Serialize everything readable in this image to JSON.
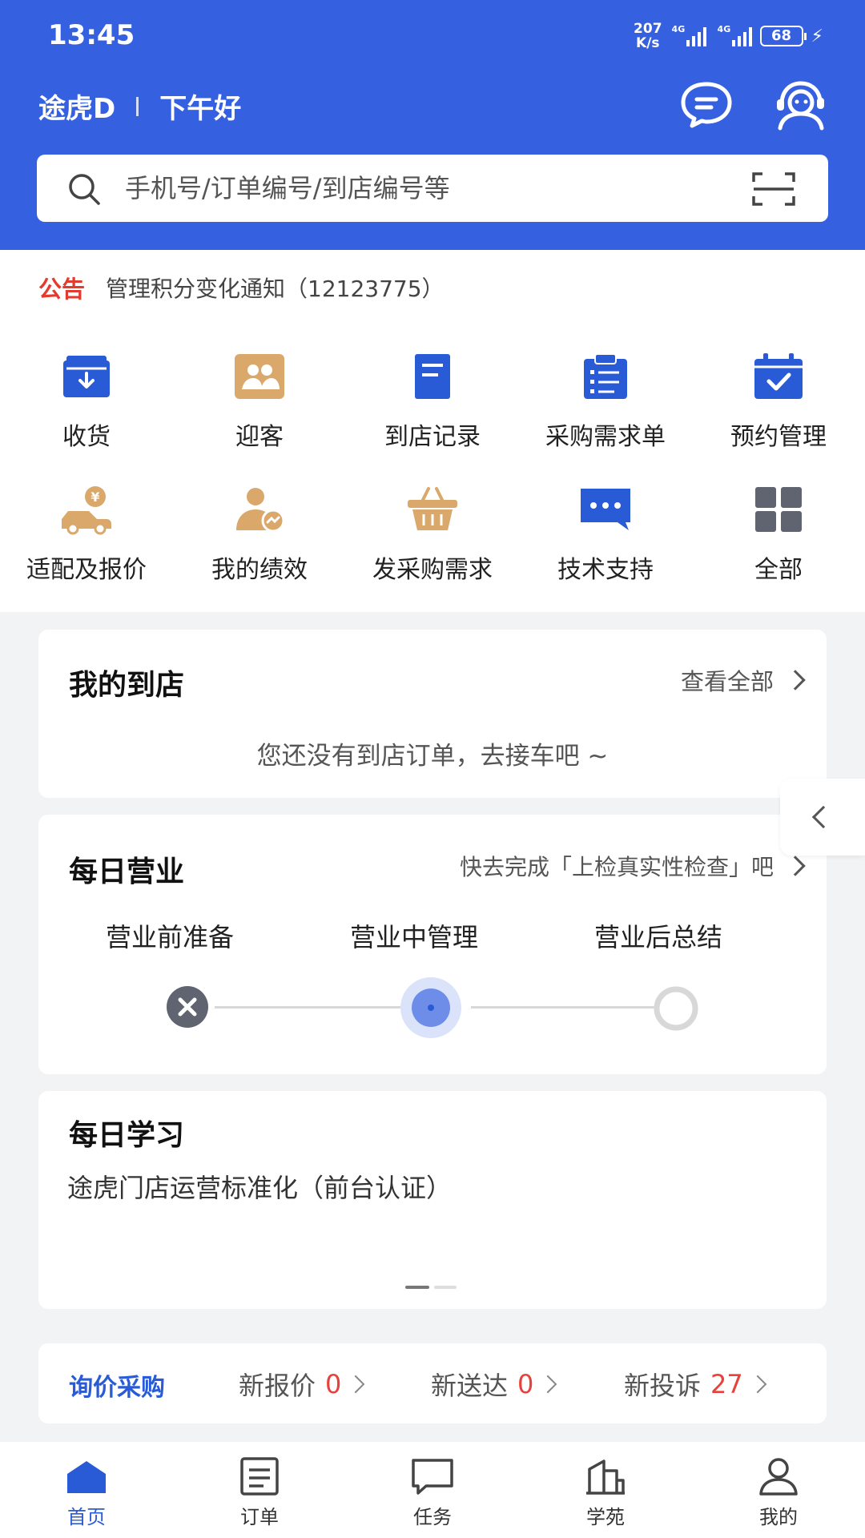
{
  "status_bar": {
    "time": "13:45",
    "net_speed_value": "207",
    "net_speed_unit": "K/s",
    "signal_1_tag": "4G",
    "signal_2_tag": "4G",
    "battery": "68"
  },
  "header": {
    "brand": "途虎D",
    "greeting": "下午好"
  },
  "search": {
    "placeholder": "手机号/订单编号/到店编号等"
  },
  "notice": {
    "tag": "公告",
    "text": "管理积分变化通知（12123775）"
  },
  "menu": [
    {
      "label": "收货",
      "icon": "receive-goods-icon"
    },
    {
      "label": "迎客",
      "icon": "welcome-guest-icon"
    },
    {
      "label": "到店记录",
      "icon": "store-record-icon"
    },
    {
      "label": "采购需求单",
      "icon": "purchase-list-icon"
    },
    {
      "label": "预约管理",
      "icon": "appointment-icon"
    },
    {
      "label": "适配及报价",
      "icon": "car-quote-icon"
    },
    {
      "label": "我的绩效",
      "icon": "performance-icon"
    },
    {
      "label": "发采购需求",
      "icon": "basket-icon"
    },
    {
      "label": "技术支持",
      "icon": "tech-support-icon"
    },
    {
      "label": "全部",
      "icon": "all-grid-icon"
    }
  ],
  "my_visits": {
    "title": "我的到店",
    "link": "查看全部",
    "empty": "您还没有到店订单，去接车吧 ~"
  },
  "daily_business": {
    "title": "每日营业",
    "hint": "快去完成「上检真实性检查」吧",
    "steps": [
      "营业前准备",
      "营业中管理",
      "营业后总结"
    ]
  },
  "daily_learning": {
    "title": "每日学习",
    "course": "途虎门店运营标准化（前台认证）"
  },
  "procurement": {
    "title": "询价采购",
    "items": [
      {
        "label": "新报价",
        "count": "0"
      },
      {
        "label": "新送达",
        "count": "0"
      },
      {
        "label": "新投诉",
        "count": "27"
      }
    ]
  },
  "bottom_nav": [
    {
      "label": "首页",
      "active": true
    },
    {
      "label": "订单",
      "active": false
    },
    {
      "label": "任务",
      "active": false
    },
    {
      "label": "学苑",
      "active": false
    },
    {
      "label": "我的",
      "active": false
    }
  ],
  "colors": {
    "brand_blue": "#3560e0",
    "accent_red": "#e8413c",
    "gold": "#d9a86a",
    "inactive_gray": "#5f6470"
  }
}
